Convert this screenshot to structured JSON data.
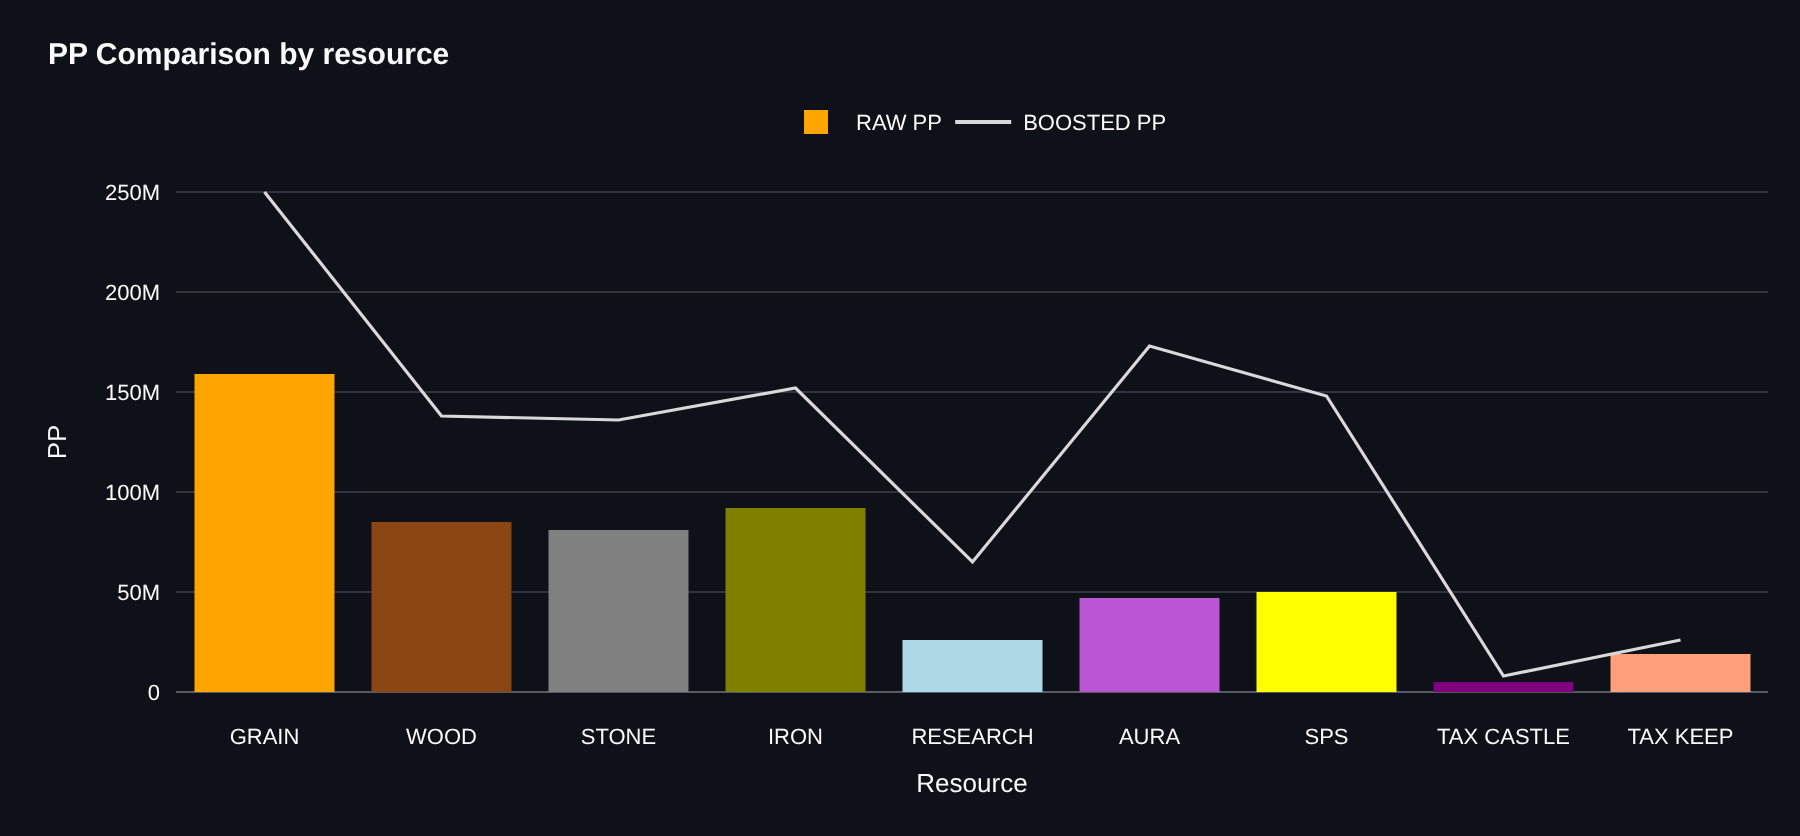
{
  "title": "PP Comparison by resource",
  "chart_data": {
    "type": "bar",
    "xlabel": "Resource",
    "ylabel": "PP",
    "categories": [
      "GRAIN",
      "WOOD",
      "STONE",
      "IRON",
      "RESEARCH",
      "AURA",
      "SPS",
      "TAX CASTLE",
      "TAX KEEP"
    ],
    "series": [
      {
        "name": "RAW PP",
        "color": "#ffa500",
        "colors": [
          "#ffa500",
          "#8b4513",
          "#808080",
          "#808000",
          "#add8e6",
          "#ba55d3",
          "#ffff00",
          "#800080",
          "#ffa07a"
        ],
        "values": [
          159,
          85,
          81,
          92,
          26,
          47,
          50,
          5,
          19
        ]
      },
      {
        "name": "BOOSTED PP",
        "type": "line",
        "color": "#d9d9d9",
        "values": [
          250,
          138,
          136,
          152,
          65,
          173,
          148,
          8,
          26
        ]
      }
    ],
    "ylim": [
      0,
      250
    ],
    "grid": true,
    "legend": "top",
    "yticks": [
      {
        "value": 0,
        "label": "0"
      },
      {
        "value": 50,
        "label": "50M"
      },
      {
        "value": 100,
        "label": "100M"
      },
      {
        "value": 150,
        "label": "150M"
      },
      {
        "value": 200,
        "label": "200M"
      },
      {
        "value": 250,
        "label": "250M"
      }
    ]
  }
}
